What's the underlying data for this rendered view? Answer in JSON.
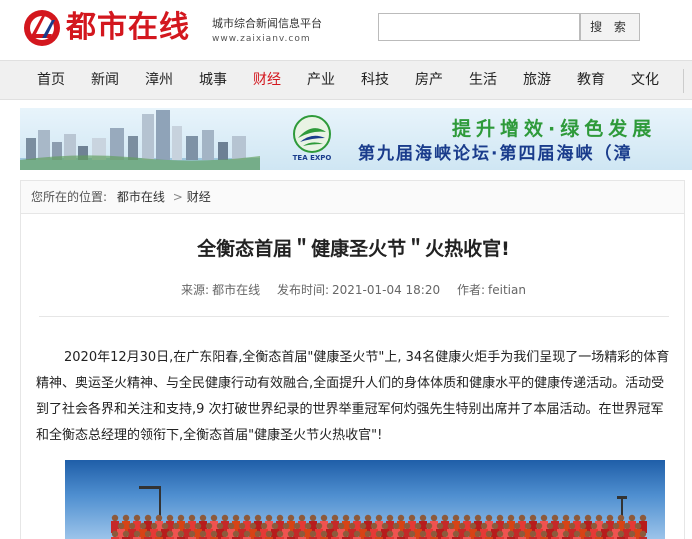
{
  "header": {
    "site_name": "都市在线",
    "slogan": "城市综合新闻信息平台",
    "domain": "www.zaixianv.com",
    "search": {
      "placeholder": "",
      "button_label": "搜 索"
    }
  },
  "nav": {
    "items": [
      {
        "label": "首页",
        "active": false
      },
      {
        "label": "新闻",
        "active": false
      },
      {
        "label": "漳州",
        "active": false
      },
      {
        "label": "城事",
        "active": false
      },
      {
        "label": "财经",
        "active": true
      },
      {
        "label": "产业",
        "active": false
      },
      {
        "label": "科技",
        "active": false
      },
      {
        "label": "房产",
        "active": false
      },
      {
        "label": "生活",
        "active": false
      },
      {
        "label": "旅游",
        "active": false
      },
      {
        "label": "教育",
        "active": false
      },
      {
        "label": "文化",
        "active": false
      }
    ]
  },
  "banner": {
    "line1": "提升增效·绿色发展",
    "line2": "第九届海峡论坛·第四届海峡（漳",
    "tea_expo_label": "TEA EXPO"
  },
  "breadcrumb": {
    "prefix": "您所在的位置:",
    "home": "都市在线",
    "separator": ">",
    "current": "财经"
  },
  "article": {
    "title": "全衡态首届＂健康圣火节＂火热收官!",
    "meta": {
      "source_label": "来源:",
      "source": "都市在线",
      "time_label": "发布时间:",
      "time": "2021-01-04 18:20",
      "author_label": "作者:",
      "author": "feitian"
    },
    "body": "2020年12月30日,在广东阳春,全衡态首届\"健康圣火节\"上, 34名健康火炬手为我们呈现了一场精彩的体育精神、奥运圣火精神、与全民健康行动有效融合,全面提升人们的身体体质和健康水平的健康传递活动。活动受到了社会各界和关注和支持,9 次打破世界纪录的世界举重冠军何灼强先生特别出席并了本届活动。在世界冠军和全衡态总经理的领衔下,全衡态首届\"健康圣火节火热收官\"!"
  },
  "colors": {
    "brand_red": "#d3171e",
    "banner_green": "#2e9a3a",
    "banner_blue": "#1a3c8c"
  }
}
